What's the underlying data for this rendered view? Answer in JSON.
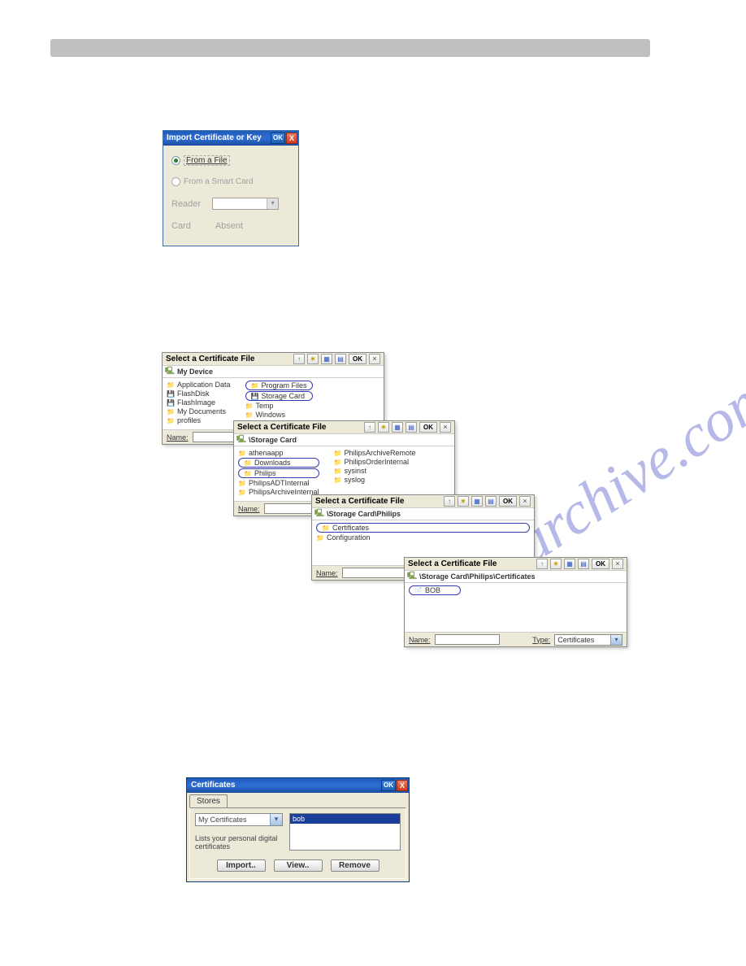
{
  "watermark": "manuarchive.com",
  "dlg_import": {
    "title": "Import Certificate or Key",
    "ok": "OK",
    "close": "X",
    "opt_file": "From a File",
    "opt_smart": "From a Smart Card",
    "reader_label": "Reader",
    "card_label": "Card",
    "card_status": "Absent"
  },
  "filewin": {
    "title": "Select a Certificate File",
    "ok": "OK",
    "close": "×",
    "name_label": "Name:",
    "type_label": "Type:",
    "type_value": "Certificates"
  },
  "fw1": {
    "path": "My Device",
    "col1": [
      "Application Data",
      "FlashDisk",
      "FlashImage",
      "My Documents",
      "profiles"
    ],
    "col2": [
      "Program Files",
      "Storage Card",
      "Temp",
      "Windows"
    ]
  },
  "fw2": {
    "path": "\\Storage Card",
    "col1": [
      "athenaapp",
      "Downloads",
      "Philips",
      "PhilipsADTInternal",
      "PhilipsArchiveInternal"
    ],
    "col2": [
      "PhilipsArchiveRemote",
      "PhilipsOrderInternal",
      "sysinst",
      "syslog"
    ]
  },
  "fw3": {
    "path": "\\Storage Card\\Philips",
    "items": [
      "Certificates",
      "Configuration"
    ]
  },
  "fw4": {
    "path": "\\Storage Card\\Philips\\Certificates",
    "items": [
      "BOB"
    ]
  },
  "cert": {
    "title": "Certificates",
    "ok": "OK",
    "close": "X",
    "tab": "Stores",
    "dropdown": "My Certificates",
    "selected": "bob",
    "helptext": "Lists your personal digital certificates",
    "btn_import": "Import..",
    "btn_view": "View..",
    "btn_remove": "Remove"
  }
}
